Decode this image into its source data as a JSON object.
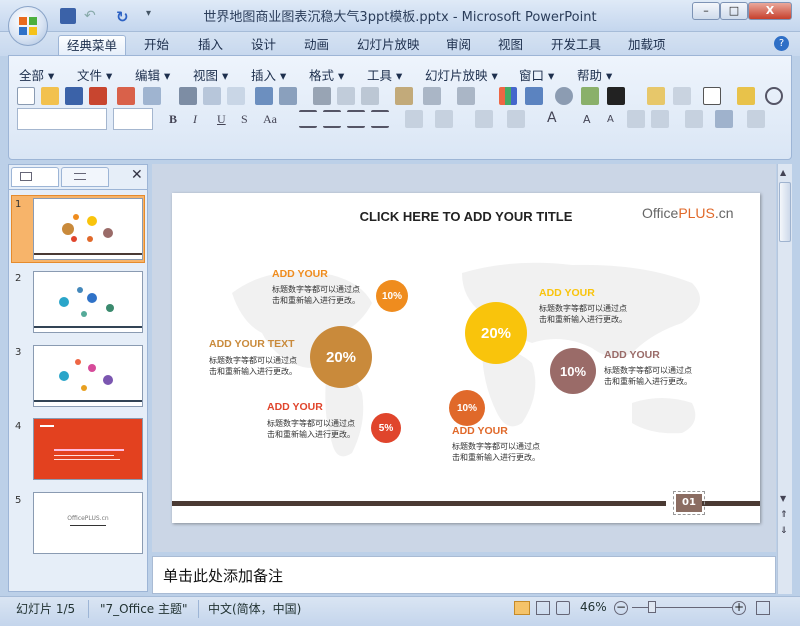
{
  "window": {
    "title": "世界地图商业图表沉稳大气3ppt模板.pptx - Microsoft PowerPoint",
    "min": "–",
    "max": "□",
    "close": "X"
  },
  "ribbon_tabs": [
    "经典菜单",
    "开始",
    "插入",
    "设计",
    "动画",
    "幻灯片放映",
    "审阅",
    "视图",
    "开发工具",
    "加载项"
  ],
  "menus": [
    "全部",
    "文件",
    "编辑",
    "视图",
    "插入",
    "格式",
    "工具",
    "幻灯片放映",
    "窗口",
    "帮助"
  ],
  "slides": [
    {
      "num": "1",
      "style": "map"
    },
    {
      "num": "2",
      "style": "map"
    },
    {
      "num": "3",
      "style": "map"
    },
    {
      "num": "4",
      "style": "red"
    },
    {
      "num": "5",
      "style": "blank",
      "caption": "OfficePLUS.cn"
    }
  ],
  "slide": {
    "title": "CLICK HERE TO ADD YOUR TITLE",
    "logo_office": "Office",
    "logo_plus": "PLUS",
    "logo_cn": ".cn",
    "page_num": "01",
    "items": [
      {
        "label": "ADD YOUR",
        "desc1": "标题数字等都可以通过点",
        "desc2": "击和重新输入进行更改。",
        "pct": "10%"
      },
      {
        "label": "ADD YOUR TEXT",
        "desc1": "标题数字等都可以通过点",
        "desc2": "击和重新输入进行更改。",
        "pct": "20%"
      },
      {
        "label": "ADD YOUR",
        "desc1": "标题数字等都可以通过点",
        "desc2": "击和重新输入进行更改。",
        "pct": "5%"
      },
      {
        "label": "ADD YOUR",
        "desc1": "标题数字等都可以通过点",
        "desc2": "击和重新输入进行更改。",
        "pct": "20%"
      },
      {
        "label": "ADD YOUR",
        "desc1": "标题数字等都可以通过点",
        "desc2": "击和重新输入进行更改。",
        "pct": "10%"
      },
      {
        "label": "ADD YOUR",
        "desc1": "标题数字等都可以通过点",
        "desc2": "击和重新输入进行更改。",
        "pct": "10%"
      }
    ]
  },
  "notes_placeholder": "单击此处添加备注",
  "status": {
    "slide_info": "幻灯片 1/5",
    "theme": "\"7_Office 主题\"",
    "language": "中文(简体，中国)",
    "zoom": "46%"
  },
  "colors": {
    "orange": "#ef8c1e",
    "brown": "#c98a3b",
    "red": "#e0452c",
    "yellow": "#f9c40c",
    "rust": "#e0692a",
    "mauve": "#9a6b68",
    "bar": "#4a3a33"
  }
}
